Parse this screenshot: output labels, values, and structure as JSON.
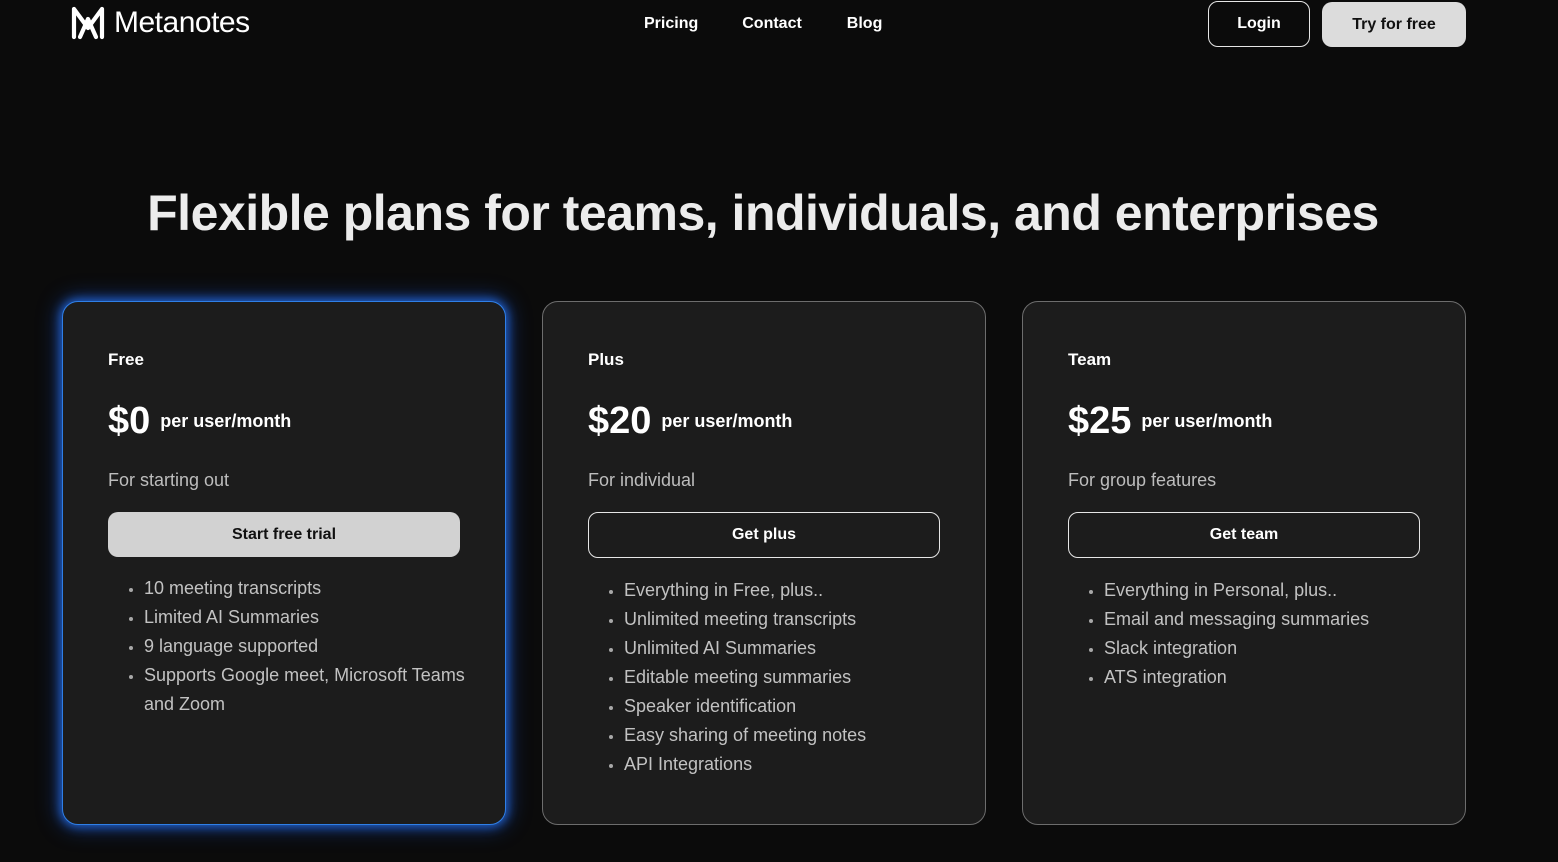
{
  "header": {
    "logo_text": "Metanotes",
    "nav": [
      "Pricing",
      "Contact",
      "Blog"
    ],
    "login_label": "Login",
    "try_label": "Try for free"
  },
  "headline": "Flexible plans for teams, individuals, and enterprises",
  "plans": [
    {
      "name": "Free",
      "price": "$0",
      "per": "per user/month",
      "description": "For starting out",
      "cta": "Start free trial",
      "features": [
        "10 meeting transcripts",
        "Limited AI Summaries",
        "9 language supported",
        "Supports Google meet, Microsoft Teams and Zoom"
      ]
    },
    {
      "name": "Plus",
      "price": "$20",
      "per": "per user/month",
      "description": "For individual",
      "cta": "Get plus",
      "features": [
        "Everything in Free, plus..",
        "Unlimited meeting transcripts",
        "Unlimited AI Summaries",
        "Editable meeting summaries",
        "Speaker identification",
        "Easy sharing of meeting notes",
        "API Integrations"
      ]
    },
    {
      "name": "Team",
      "price": "$25",
      "per": "per user/month",
      "description": "For group features",
      "cta": "Get team",
      "features": [
        "Everything in Personal, plus..",
        "Email and messaging summaries",
        "Slack integration",
        "ATS integration"
      ]
    }
  ],
  "colors": {
    "background": "#0b0b0b",
    "card": "#1c1c1c",
    "highlight_glow": "#2f7fe6"
  }
}
